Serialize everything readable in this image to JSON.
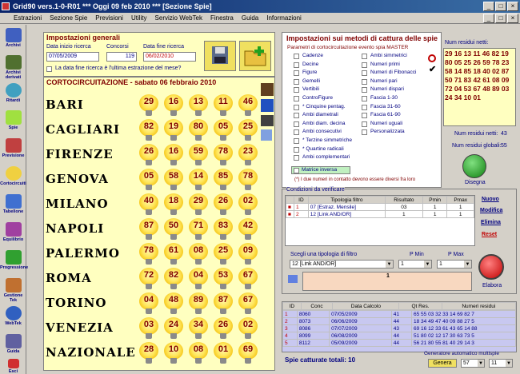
{
  "window": {
    "title": "Grid90 vers.1-0-R01   ***  Oggi 09 feb 2010   ***   [Sezione Spie]"
  },
  "menu": [
    "Estrazioni",
    "Sezione Spie",
    "Previsioni",
    "Utility",
    "Servizio WebTek",
    "Finestra",
    "Guida",
    "Informazioni"
  ],
  "sidebar": [
    "Archivi",
    "Archivi derivati",
    "Ritardi",
    "Spie",
    "Previsione",
    "Cortocircuiti",
    "Tabellone",
    "Equilibrio",
    "Progressione",
    "Gestione Tek",
    "WebTek",
    "Guida",
    "Esci"
  ],
  "general": {
    "title": "Impostazioni generali",
    "start_label": "Data inizio ricerca",
    "start_value": "07/05/2009",
    "concorsi_label": "Concorsi",
    "concorsi_value": "119",
    "end_label": "Data fine ricerca",
    "end_value": "06/02/2010",
    "check_label": "La data fine ricerca è l'ultima estrazione del mese?"
  },
  "short": {
    "title": "CORTOCIRCUITAZIONE - sabato 06 febbraio 2010"
  },
  "wheels": [
    {
      "name": "BARI",
      "nums": [
        "29",
        "16",
        "13",
        "11",
        "46"
      ]
    },
    {
      "name": "CAGLIARI",
      "nums": [
        "82",
        "19",
        "80",
        "05",
        "25"
      ]
    },
    {
      "name": "FIRENZE",
      "nums": [
        "26",
        "16",
        "59",
        "78",
        "23"
      ]
    },
    {
      "name": "GENOVA",
      "nums": [
        "05",
        "58",
        "14",
        "85",
        "78"
      ]
    },
    {
      "name": "MILANO",
      "nums": [
        "40",
        "18",
        "29",
        "26",
        "02"
      ]
    },
    {
      "name": "NAPOLI",
      "nums": [
        "87",
        "50",
        "71",
        "83",
        "42"
      ]
    },
    {
      "name": "PALERMO",
      "nums": [
        "78",
        "61",
        "08",
        "25",
        "09"
      ]
    },
    {
      "name": "ROMA",
      "nums": [
        "72",
        "82",
        "04",
        "53",
        "67"
      ]
    },
    {
      "name": "TORINO",
      "nums": [
        "04",
        "48",
        "89",
        "87",
        "67"
      ]
    },
    {
      "name": "VENEZIA",
      "nums": [
        "03",
        "24",
        "34",
        "26",
        "02"
      ]
    },
    {
      "name": "NAZIONALE",
      "nums": [
        "28",
        "10",
        "08",
        "01",
        "69"
      ]
    }
  ],
  "methods": {
    "title": "Impostazioni sui metodi di cattura delle spie",
    "params_title": "Parametri di cortocircuitazione evento spia MASTER",
    "col1": [
      "Cadenze",
      "Decine",
      "Figure",
      "Gemelli",
      "Vertibili",
      "ControFigure",
      "* Cinquine pentag.",
      "Ambi diametrali",
      "Ambi diam. decina",
      "Ambi consecutivi",
      "* Terzine simmetriche",
      "* Quartine radicali",
      "Ambi complementari"
    ],
    "col2": [
      "Ambi simmetrici",
      "Numeri primi",
      "Numeri di Fibonacci",
      "Numeri pari",
      "Numeri dispari",
      "Fascia 1-30",
      "Fascia 31-60",
      "Fascia 61-90",
      "Numeri uguali",
      "Personalizzata"
    ],
    "matrice": "Matrice inversa",
    "note": "(*) I due numeri in contatto devono essere diversi fra loro"
  },
  "residui": {
    "title": "Num residui netti:",
    "lines": [
      "29 16 13 11 46 82 19",
      "80 05 25 26 59 78 23",
      "58 14 85 18 40 02 87",
      "50 71 83 42 61 08 09",
      "72 04 53 67 48 89 03",
      "24 34 10 01"
    ],
    "netti_label": "Num residui netti:",
    "netti_value": "43",
    "globali_label": "Num residui globali:",
    "globali_value": "55",
    "disegna": "Disegna"
  },
  "conditions": {
    "title": "Condizioni da verificare",
    "headers": [
      "ID",
      "Tipologia filtro",
      "Risultato",
      "Pmin",
      "Pmax"
    ],
    "rows": [
      [
        "1",
        "07 [Estraz. Mensile]",
        "03",
        "1",
        "1"
      ],
      [
        "2",
        "12 [Link AND/OR]",
        "1",
        "1",
        "1"
      ]
    ],
    "nuovo": "Nuovo",
    "modifica": "Modifica",
    "elimina": "Elimina",
    "reset": "Reset",
    "filter_label": "Scegli una tipologia di filtro",
    "filter_value": "12 [Link AND/OR]",
    "pmin_label": "P Min",
    "pmin_value": "1",
    "pmax_label": "P Max",
    "pmax_value": "1",
    "field_value": "1",
    "elabora": "Elabora"
  },
  "results": {
    "headers": [
      "ID",
      "Conc",
      "Data Calcolo",
      "Qt Res.",
      "Numeri residui"
    ],
    "rows": [
      [
        "1",
        "8060",
        "07/05/2009",
        "41",
        "65 55 03 32 33 14 69 82 7"
      ],
      [
        "2",
        "8073",
        "06/06/2009",
        "44",
        "18 34 49 47 40 09 88 27 5"
      ],
      [
        "3",
        "8086",
        "07/07/2009",
        "43",
        "69 16 12 33 61 43 65 14 88"
      ],
      [
        "4",
        "8099",
        "06/08/2009",
        "44",
        "51 80 02 12 17 30 63 73 5"
      ],
      [
        "5",
        "8112",
        "05/09/2009",
        "44",
        "56 21 80 55 81 40 29 14 3"
      ]
    ],
    "total": "Spie catturate totali: 10",
    "gen_title": "Generatore automatico multispie",
    "genera": "Genera",
    "gen_val1": "57",
    "gen_val2": "11"
  },
  "colors": {
    "accent": "#800000",
    "bulb": "#ffe65a",
    "results_bg": "#c8c8f0"
  }
}
